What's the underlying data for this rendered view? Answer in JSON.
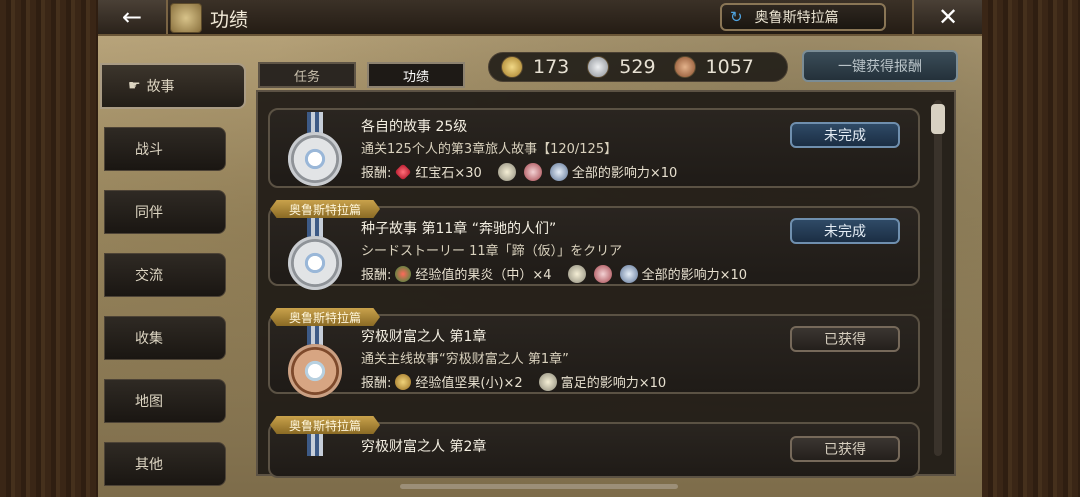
{
  "header": {
    "back_icon": "←",
    "title": "功绩",
    "chapter_label": "奥鲁斯特拉篇",
    "sync_icon": "↻",
    "close_icon": "✕"
  },
  "sidebar": {
    "items": [
      {
        "label": "故事",
        "icon": "☛"
      },
      {
        "label": "战斗"
      },
      {
        "label": "同伴"
      },
      {
        "label": "交流"
      },
      {
        "label": "收集"
      },
      {
        "label": "地图"
      },
      {
        "label": "其他"
      }
    ]
  },
  "tabs": {
    "task": "任务",
    "achievement": "功绩"
  },
  "currency": {
    "gold": "173",
    "silver": "529",
    "bronze": "1057"
  },
  "claim_all_label": "一键获得报酬",
  "rows": [
    {
      "title": "各自的故事  25级",
      "desc": "通关125个人的第3章旅人故事【120/125】",
      "reward_prefix": "报酬:",
      "reward_1": "红宝石×30",
      "reward_2": "全部的影响力×10",
      "status": "未完成"
    },
    {
      "ribbon": "奥鲁斯特拉篇",
      "title": "种子故事  第11章 “奔驰的人们”",
      "desc": "シードストーリー 11章「蹄（仮）」をクリア",
      "reward_prefix": "报酬:",
      "reward_1": "经验值的果炎（中）×4",
      "reward_2": "全部的影响力×10",
      "status": "未完成"
    },
    {
      "ribbon": "奥鲁斯特拉篇",
      "title": "穷极财富之人  第1章",
      "desc": "通关主线故事“穷极财富之人  第1章”",
      "reward_prefix": "报酬:",
      "reward_1": "经验值坚果(小)×2",
      "reward_2": "富足的影响力×10",
      "status": "已获得"
    },
    {
      "ribbon": "奥鲁斯特拉篇",
      "title": "穷极财富之人  第2章",
      "status": "已获得"
    }
  ]
}
